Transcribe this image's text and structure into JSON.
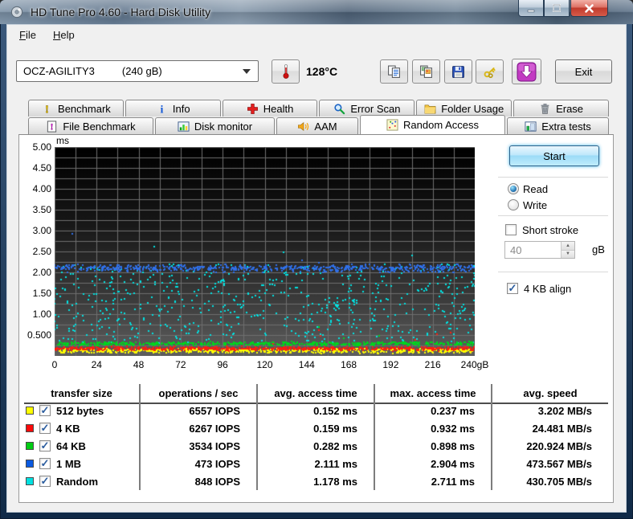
{
  "window": {
    "title": "HD Tune Pro 4.60 - Hard Disk Utility"
  },
  "menu": {
    "items": [
      {
        "label": "File"
      },
      {
        "label": "Help"
      }
    ]
  },
  "toolbar": {
    "drive_selector": {
      "name": "OCZ-AGILITY3",
      "size": "(240 gB)"
    },
    "temperature": "128°C",
    "buttons": [
      {
        "name": "copy-text-button",
        "icon": "copy-text-icon"
      },
      {
        "name": "copy-image-button",
        "icon": "copy-image-icon"
      },
      {
        "name": "save-button",
        "icon": "save-icon"
      },
      {
        "name": "options-button",
        "icon": "keys-icon"
      },
      {
        "name": "download-button",
        "icon": "download-arrow-icon"
      }
    ],
    "exit_label": "Exit"
  },
  "tabs": {
    "row1": [
      {
        "label": "Benchmark",
        "icon": "benchmark-icon"
      },
      {
        "label": "Info",
        "icon": "info-icon"
      },
      {
        "label": "Health",
        "icon": "health-icon"
      },
      {
        "label": "Error Scan",
        "icon": "error-scan-icon"
      },
      {
        "label": "Folder Usage",
        "icon": "folder-usage-icon"
      },
      {
        "label": "Erase",
        "icon": "erase-icon"
      }
    ],
    "row2": [
      {
        "label": "File Benchmark",
        "icon": "file-benchmark-icon",
        "active": false
      },
      {
        "label": "Disk monitor",
        "icon": "disk-monitor-icon",
        "active": false
      },
      {
        "label": "AAM",
        "icon": "aam-icon",
        "active": false
      },
      {
        "label": "Random Access",
        "icon": "random-access-icon",
        "active": true
      },
      {
        "label": "Extra tests",
        "icon": "extra-tests-icon",
        "active": false
      }
    ]
  },
  "controls": {
    "start_label": "Start",
    "read_label": "Read",
    "write_label": "Write",
    "read_selected": true,
    "short_stroke_label": "Short stroke",
    "short_stroke_checked": false,
    "stroke_size_value": "40",
    "stroke_size_unit": "gB",
    "align_label": "4 KB align",
    "align_checked": true
  },
  "chart": {
    "type": "scatter",
    "y_unit": "ms",
    "y_max_ms": 5,
    "x_max_gb": 240,
    "y_tick_labels": [
      "5.00",
      "4.50",
      "4.00",
      "3.50",
      "3.00",
      "2.50",
      "2.00",
      "1.50",
      "1.00",
      "0.500"
    ],
    "x_tick_labels": [
      "0",
      "24",
      "48",
      "72",
      "96",
      "120",
      "144",
      "168",
      "192",
      "216",
      "240gB"
    ],
    "background_top": "#000000",
    "background_bottom": "#5f5f5f",
    "grid_color": "#6f6f6f",
    "series": [
      {
        "name": "512 bytes",
        "color": "#ffff00",
        "mode": "band",
        "center_ms": 0.125,
        "spread_ms": 0.035,
        "tail_p": 0.01,
        "tail_amp": 0.25,
        "points": 620
      },
      {
        "name": "4 KB",
        "color": "#ff1d10",
        "mode": "band",
        "center_ms": 0.175,
        "spread_ms": 0.03,
        "tail_p": 0.008,
        "tail_amp": 0.55,
        "points": 620
      },
      {
        "name": "64 KB",
        "color": "#00d41e",
        "mode": "band",
        "center_ms": 0.29,
        "spread_ms": 0.028,
        "tail_p": 0.01,
        "tail_amp": 0.45,
        "points": 560
      },
      {
        "name": "1 MB",
        "color": "#2f6fe8",
        "mode": "band",
        "center_ms": 2.1,
        "spread_ms": 0.055,
        "tail_p": 0.006,
        "tail_amp": 0.3,
        "points": 640,
        "outliers": [
          {
            "x_gb": 10,
            "y_ms": 2.92
          }
        ]
      },
      {
        "name": "Random",
        "color": "#00e2e2",
        "mode": "scatter",
        "min_ms": 0.3,
        "max_ms": 2.2,
        "tail_p": 0.006,
        "tail_amp": 0.5,
        "points": 640,
        "outliers": [
          {
            "x_gb": 57,
            "y_ms": 2.62
          },
          {
            "x_gb": 131,
            "y_ms": 2.48
          },
          {
            "x_gb": 204,
            "y_ms": 2.4
          }
        ]
      }
    ]
  },
  "table": {
    "headers": [
      "transfer size",
      "operations / sec",
      "avg. access time",
      "max. access time",
      "avg. speed"
    ],
    "rows": [
      {
        "color": "#ffff00",
        "label": "512 bytes",
        "checked": true,
        "ops": "6557 IOPS",
        "avg": "0.152 ms",
        "max": "0.237 ms",
        "speed": "3.202 MB/s"
      },
      {
        "color": "#fb0a0a",
        "label": "4 KB",
        "checked": true,
        "ops": "6267 IOPS",
        "avg": "0.159 ms",
        "max": "0.932 ms",
        "speed": "24.481 MB/s"
      },
      {
        "color": "#00cc14",
        "label": "64 KB",
        "checked": true,
        "ops": "3534 IOPS",
        "avg": "0.282 ms",
        "max": "0.898 ms",
        "speed": "220.924 MB/s"
      },
      {
        "color": "#0a5ae1",
        "label": "1 MB",
        "checked": true,
        "ops": "473 IOPS",
        "avg": "2.111 ms",
        "max": "2.904 ms",
        "speed": "473.567 MB/s"
      },
      {
        "color": "#00e0e0",
        "label": "Random",
        "checked": true,
        "ops": "848 IOPS",
        "avg": "1.178 ms",
        "max": "2.711 ms",
        "speed": "430.705 MB/s"
      }
    ]
  }
}
